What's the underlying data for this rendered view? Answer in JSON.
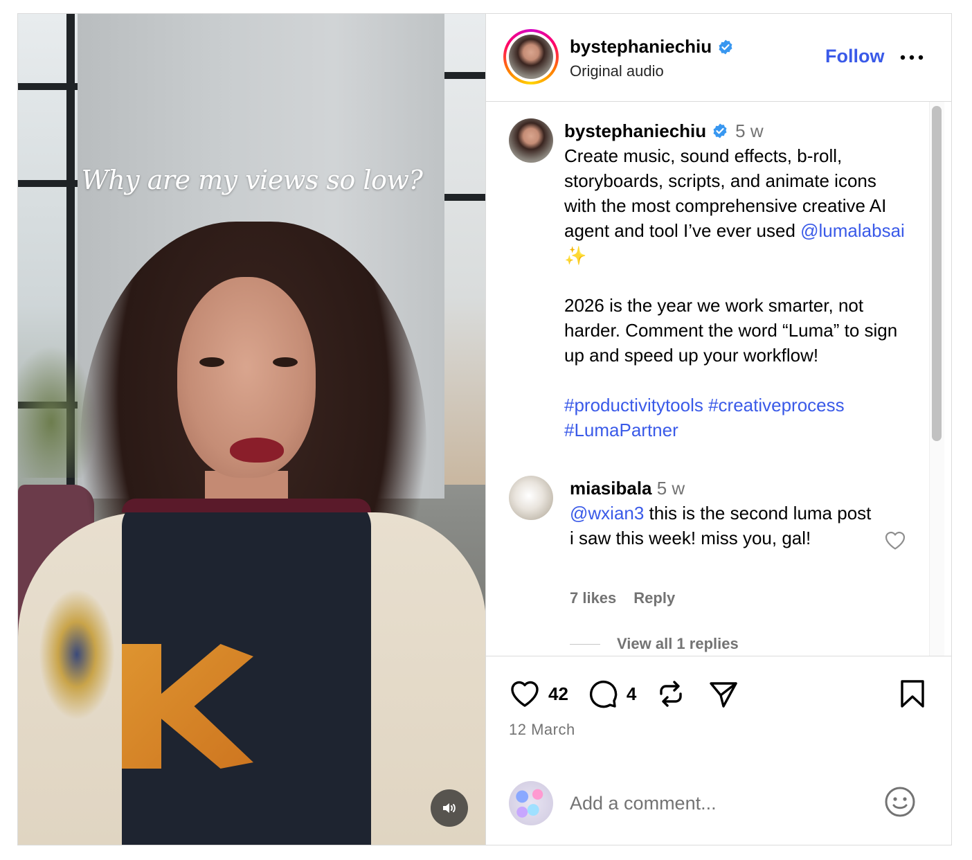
{
  "video": {
    "overlay_text": "Why are my views so low?"
  },
  "header": {
    "username": "bystephaniechiu",
    "subtitle": "Original audio",
    "follow_label": "Follow"
  },
  "caption": {
    "username": "bystephaniechiu",
    "time": "5 w",
    "line1": "Create music, sound effects, b-roll, storyboards, scripts, and animate icons with the most comprehensive creative AI agent and tool I’ve ever used ",
    "mention": "@lumalabsai",
    "sparkle": "✨",
    "paragraph2": "2026 is the year we work smarter, not harder. Comment the word “Luma” to sign up and speed up your workflow!",
    "hashtags": "#productivitytools #creativeprocess #LumaPartner"
  },
  "comment": {
    "username": "miasibala",
    "time": "5 w",
    "mention": "@wxian3",
    "text": " this is the second luma post i saw this week! miss you, gal!",
    "likes": "7 likes",
    "reply_label": "Reply",
    "view_replies": "View all 1 replies"
  },
  "actions": {
    "like_count": "42",
    "comment_count": "4",
    "date": "12 March"
  },
  "add_comment": {
    "placeholder": "Add a comment..."
  },
  "colors": {
    "link": "#3a5ae8",
    "verified": "#3897f0",
    "muted": "#737373"
  }
}
